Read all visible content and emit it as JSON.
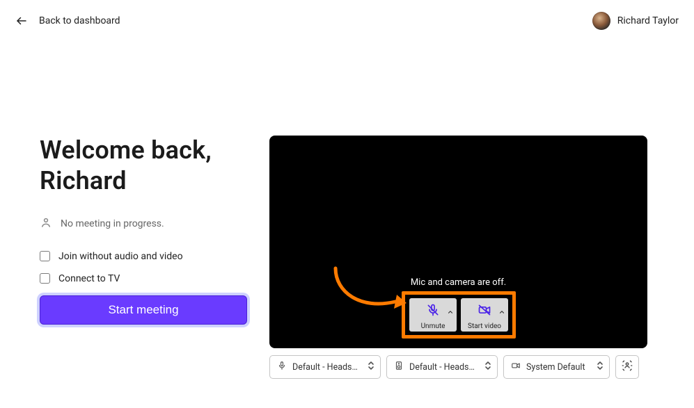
{
  "header": {
    "back_label": "Back to dashboard",
    "user_name": "Richard Taylor"
  },
  "welcome": {
    "title_line1": "Welcome back,",
    "title_line2": "Richard"
  },
  "status": {
    "text": "No meeting in progress."
  },
  "options": {
    "join_without_av": "Join without audio and video",
    "connect_tv": "Connect to TV"
  },
  "primary_action": {
    "start_meeting": "Start meeting"
  },
  "preview": {
    "status_text": "Mic and camera are off.",
    "controls": {
      "unmute": "Unmute",
      "start_video": "Start video"
    }
  },
  "devices": {
    "mic": "Default - Headset Mi…",
    "speaker": "Default - Headset Ea…",
    "camera": "System Default"
  }
}
